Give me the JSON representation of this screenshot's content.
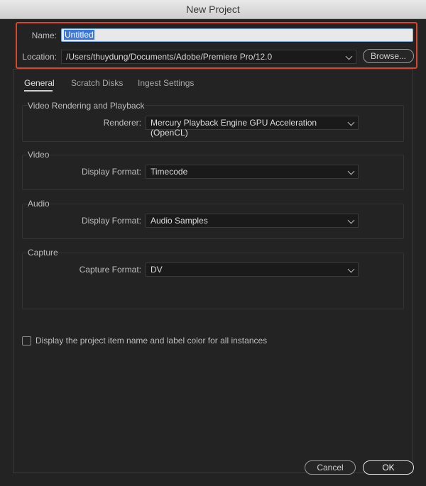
{
  "window": {
    "title": "New Project"
  },
  "project": {
    "name_label": "Name:",
    "name_value": "Untitled",
    "location_label": "Location:",
    "location_value": "/Users/thuydung/Documents/Adobe/Premiere Pro/12.0",
    "browse_label": "Browse..."
  },
  "tabs": [
    {
      "label": "General",
      "active": true
    },
    {
      "label": "Scratch Disks",
      "active": false
    },
    {
      "label": "Ingest Settings",
      "active": false
    }
  ],
  "groups": {
    "rendering": {
      "title": "Video Rendering and Playback",
      "field_label": "Renderer:",
      "value": "Mercury Playback Engine GPU Acceleration (OpenCL)"
    },
    "video": {
      "title": "Video",
      "field_label": "Display Format:",
      "value": "Timecode"
    },
    "audio": {
      "title": "Audio",
      "field_label": "Display Format:",
      "value": "Audio Samples"
    },
    "capture": {
      "title": "Capture",
      "field_label": "Capture Format:",
      "value": "DV"
    }
  },
  "checkbox": {
    "label": "Display the project item name and label color for all instances",
    "checked": false
  },
  "footer": {
    "cancel_label": "Cancel",
    "ok_label": "OK"
  },
  "colors": {
    "highlight": "#d9452d",
    "selection": "#3c78d8",
    "background": "#232323"
  },
  "icons": {
    "dropdown": "chevron-down-icon",
    "checkbox": "checkbox-icon"
  }
}
